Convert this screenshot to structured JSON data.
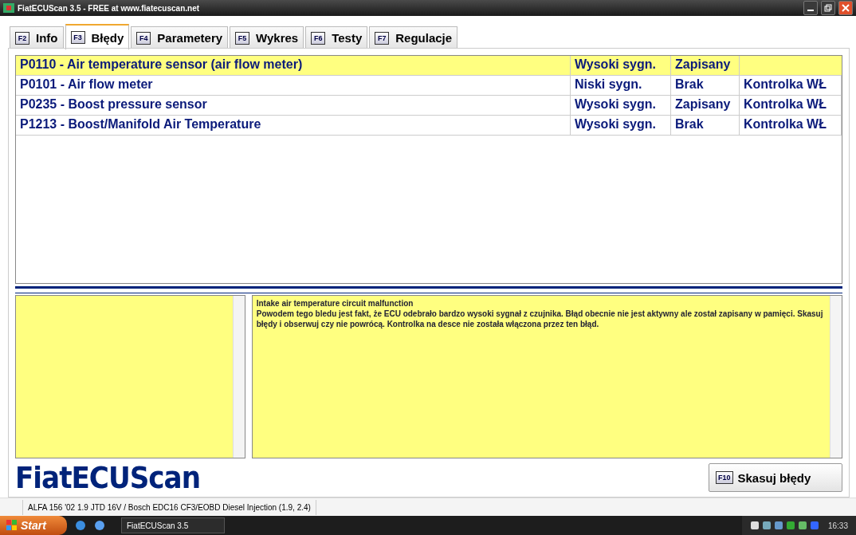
{
  "window": {
    "title": "FiatECUScan 3.5 - FREE at www.fiatecuscan.net"
  },
  "tabs": [
    {
      "key": "F2",
      "label": "Info",
      "selected": false
    },
    {
      "key": "F3",
      "label": "Błędy",
      "selected": true
    },
    {
      "key": "F4",
      "label": "Parametery",
      "selected": false
    },
    {
      "key": "F5",
      "label": "Wykres",
      "selected": false
    },
    {
      "key": "F6",
      "label": "Testy",
      "selected": false
    },
    {
      "key": "F7",
      "label": "Regulacje",
      "selected": false
    }
  ],
  "faults": [
    {
      "selected": true,
      "cells": [
        "P0110 - Air temperature sensor (air flow meter)",
        "Wysoki sygn.",
        "Zapisany"
      ]
    },
    {
      "selected": false,
      "cells": [
        "P0101 - Air flow meter",
        "Niski sygn.",
        "Brak",
        "Kontrolka WŁ"
      ]
    },
    {
      "selected": false,
      "cells": [
        "P0235 - Boost pressure sensor",
        "Wysoki sygn.",
        "Zapisany",
        "Kontrolka WŁ"
      ]
    },
    {
      "selected": false,
      "cells": [
        "P1213 - Boost/Manifold Air Temperature",
        "Wysoki sygn.",
        "Brak",
        "Kontrolka WŁ"
      ]
    }
  ],
  "description": {
    "title": "Intake air temperature circuit malfunction",
    "text": "Powodem tego bledu jest fakt, że ECU odebrało bardzo wysoki sygnał z czujnika. Błąd obecnie nie jest aktywny ale został zapisany w pamięci. Skasuj błędy i obserwuj czy nie powrócą. Kontrolka na desce nie została włączona przez ten błąd."
  },
  "logo": "FiatECUScan",
  "clear_button": {
    "key": "F10",
    "label": "Skasuj błędy"
  },
  "status_bar": "ALFA 156 '02 1.9 JTD 16V / Bosch EDC16 CF3/EOBD Diesel Injection (1.9, 2.4)",
  "taskbar": {
    "start": "Start",
    "task": "FiatECUScan 3.5",
    "clock": "16:33"
  }
}
